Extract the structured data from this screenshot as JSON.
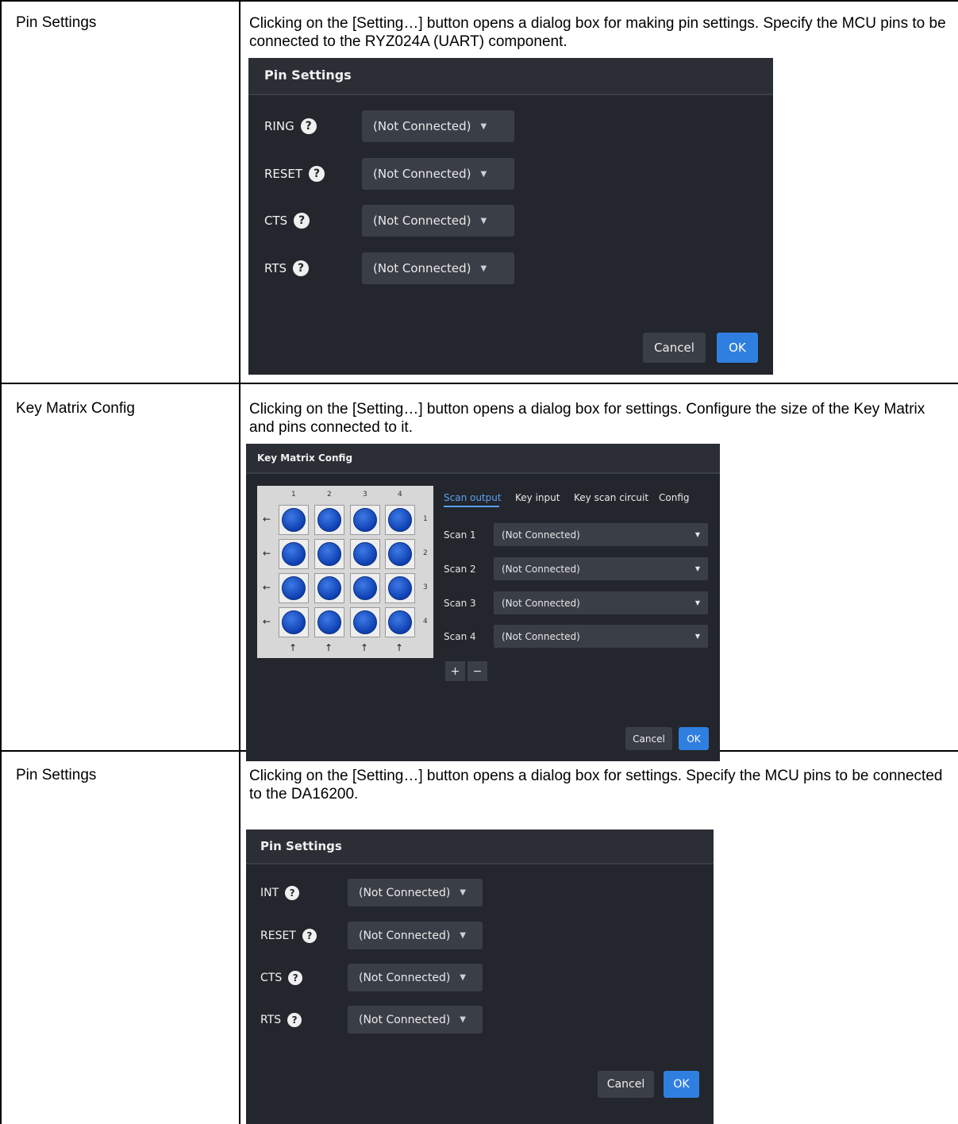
{
  "rows": [
    {
      "label": "Pin Settings",
      "description": "Clicking on the [Setting…] button opens a dialog box for making pin settings. Specify the MCU pins to be connected to the RYZ024A (UART) component.",
      "dialog": {
        "title": "Pin Settings",
        "pins": [
          {
            "name": "RING",
            "value": "(Not Connected)"
          },
          {
            "name": "RESET",
            "value": "(Not Connected)"
          },
          {
            "name": "CTS",
            "value": "(Not Connected)"
          },
          {
            "name": "RTS",
            "value": "(Not Connected)"
          }
        ],
        "cancel": "Cancel",
        "ok": "OK"
      }
    },
    {
      "label": "Key Matrix Config",
      "description": "Clicking on the [Setting…] button opens a dialog box for settings. Configure the size of the Key Matrix and pins connected to it.",
      "dialog": {
        "title": "Key Matrix Config",
        "columns": [
          "1",
          "2",
          "3",
          "4"
        ],
        "rows": [
          "1",
          "2",
          "3",
          "4"
        ],
        "tabs": [
          "Scan output",
          "Key input",
          "Key scan circuit",
          "Config"
        ],
        "scans": [
          {
            "name": "Scan 1",
            "value": "(Not Connected)"
          },
          {
            "name": "Scan 2",
            "value": "(Not Connected)"
          },
          {
            "name": "Scan 3",
            "value": "(Not Connected)"
          },
          {
            "name": "Scan 4",
            "value": "(Not Connected)"
          }
        ],
        "add": "+",
        "remove": "−",
        "cancel": "Cancel",
        "ok": "OK"
      }
    },
    {
      "label": "Pin Settings",
      "description": "Clicking on the [Setting…] button opens a dialog box for settings. Specify the MCU pins to be connected to the DA16200.",
      "dialog": {
        "title": "Pin Settings",
        "pins": [
          {
            "name": "INT",
            "value": "(Not Connected)"
          },
          {
            "name": "RESET",
            "value": "(Not Connected)"
          },
          {
            "name": "CTS",
            "value": "(Not Connected)"
          },
          {
            "name": "RTS",
            "value": "(Not Connected)"
          }
        ],
        "cancel": "Cancel",
        "ok": "OK"
      }
    }
  ],
  "icons": {
    "help": "?",
    "caret": "▼",
    "left_arrow": "←",
    "up_arrow": "↑"
  }
}
